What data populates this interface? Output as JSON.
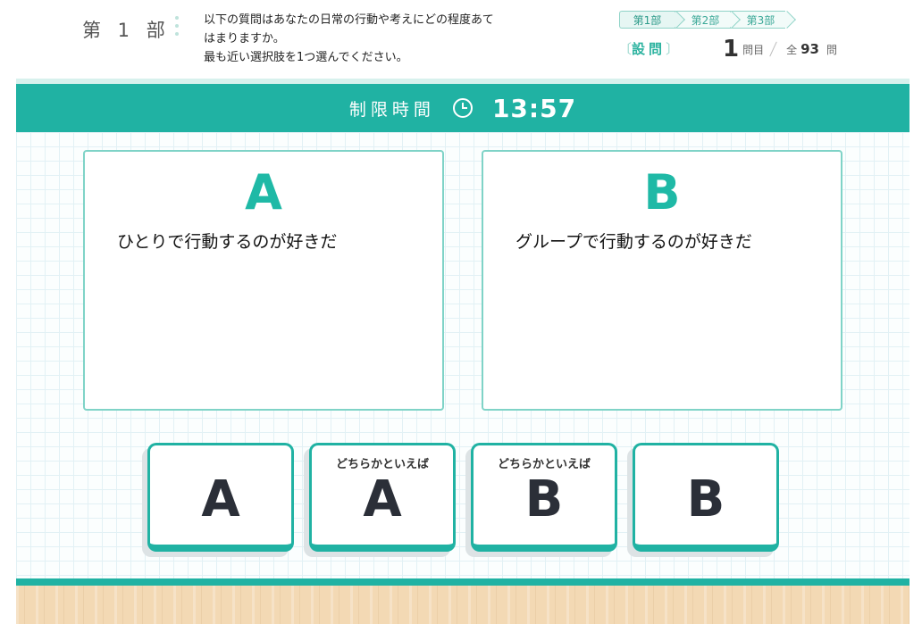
{
  "header": {
    "part_label": "第 1 部",
    "instructions": [
      "以下の質問はあなたの日常の行動や考えにどの程度あて",
      "はまりますか。",
      "最も近い選択肢を1つ選んでください。"
    ],
    "steps": [
      "第1部",
      "第2部",
      "第3部"
    ],
    "question_tag": "設問",
    "counter": {
      "current": "1",
      "current_unit": "問目",
      "total_prefix": "全",
      "total": "93",
      "total_unit": "問"
    }
  },
  "timer": {
    "label": "制限時間",
    "value": "13:57",
    "icon": "clock-icon"
  },
  "cards": [
    {
      "letter": "A",
      "text": "ひとりで行動するのが好きだ"
    },
    {
      "letter": "B",
      "text": "グループで行動するのが好きだ"
    }
  ],
  "choices": [
    {
      "sub": "",
      "letter": "A"
    },
    {
      "sub": "どちらかといえば",
      "letter": "A"
    },
    {
      "sub": "どちらかといえば",
      "letter": "B"
    },
    {
      "sub": "",
      "letter": "B"
    }
  ],
  "colors": {
    "accent": "#20b2a3",
    "letter": "#1fb9a6",
    "floor": "#f3d9b4"
  }
}
